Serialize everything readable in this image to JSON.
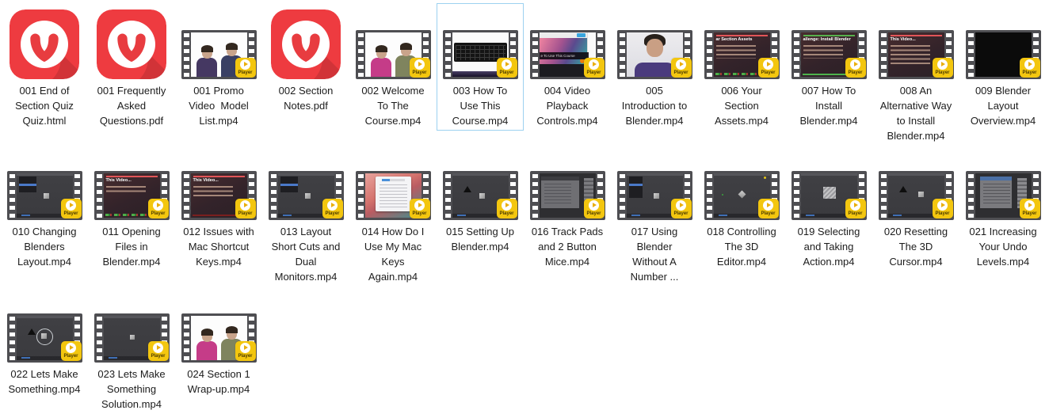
{
  "app": {
    "background": "#ffffff",
    "selection_border": "#9cd1f0",
    "label_color": "#1c1c1c"
  },
  "player_badge": {
    "label": "Player",
    "color": "#f3c60f"
  },
  "icons": {
    "vivaldi_red": "#ee3b40",
    "film_gray": "#4e4e52"
  },
  "files": {
    "rows": [
      {
        "items": [
          {
            "name": "001 End of Section Quiz Quiz.html",
            "icon": "vivaldi"
          },
          {
            "name": "001 Frequently Asked Questions.pdf",
            "icon": "vivaldi"
          },
          {
            "name": "001 Promo Video  Model List.mp4",
            "icon": "film",
            "thumb": "men-dark"
          },
          {
            "name": "002 Section Notes.pdf",
            "icon": "vivaldi"
          },
          {
            "name": "002 Welcome To The Course.mp4",
            "icon": "film",
            "thumb": "men-pink"
          },
          {
            "name": "003 How To Use This Course.mp4",
            "icon": "film",
            "thumb": "keyboard",
            "selected": true
          },
          {
            "name": "004 Video Playback Controls.mp4",
            "icon": "film",
            "thumb": "splash",
            "thumb_text": "e To Use This Course"
          },
          {
            "name": "005 Introduction to Blender.mp4",
            "icon": "film",
            "thumb": "portrait"
          },
          {
            "name": "006 Your Section Assets.mp4",
            "icon": "film",
            "thumb": "slide-a",
            "thumb_text": "ar Section Assets"
          },
          {
            "name": "007 How To Install Blender.mp4",
            "icon": "film",
            "thumb": "slide-b",
            "thumb_text": "allenge: Install Blender"
          },
          {
            "name": "008 An Alternative Way to Install Blender.mp4",
            "icon": "film",
            "thumb": "slide-c",
            "thumb_text": "This Video..."
          },
          {
            "name": "009 Blender Layout Overview.mp4",
            "icon": "film",
            "thumb": "black"
          }
        ]
      },
      {
        "items": [
          {
            "name": "010 Changing Blenders Layout.mp4",
            "icon": "film",
            "thumb": "bui"
          },
          {
            "name": "011 Opening Files in Blender.mp4",
            "icon": "film",
            "thumb": "slide-d",
            "thumb_text": "This Video..."
          },
          {
            "name": "012 Issues with Mac Shortcut Keys.mp4",
            "icon": "film",
            "thumb": "slide-e",
            "thumb_text": "This Video..."
          },
          {
            "name": "013 Layout Short Cuts and Dual Monitors.mp4",
            "icon": "film",
            "thumb": "bui"
          },
          {
            "name": "014 How Do I Use My Mac Keys Again.mp4",
            "icon": "film",
            "thumb": "mac"
          },
          {
            "name": "015 Setting Up Blender.mp4",
            "icon": "film",
            "thumb": "v3-cube"
          },
          {
            "name": "016 Track Pads and 2 Button Mice.mp4",
            "icon": "film",
            "thumb": "prefs-a"
          },
          {
            "name": "017 Using Blender Without A Number ...",
            "icon": "film",
            "thumb": "bui-b"
          },
          {
            "name": "018 Controlling The 3D Editor.mp4",
            "icon": "film",
            "thumb": "v3-diamond"
          },
          {
            "name": "019 Selecting and Taking Action.mp4",
            "icon": "film",
            "thumb": "v3-bigcube"
          },
          {
            "name": "020 Resetting The 3D Cursor.mp4",
            "icon": "film",
            "thumb": "v3-cube-r"
          },
          {
            "name": "021 Increasing Your Undo Levels.mp4",
            "icon": "film",
            "thumb": "prefs-b"
          }
        ]
      },
      {
        "items": [
          {
            "name": "022 Lets Make Something.mp4",
            "icon": "film",
            "thumb": "v3-circle"
          },
          {
            "name": "023 Lets Make Something Solution.mp4",
            "icon": "film",
            "thumb": "v3-cube-sm"
          },
          {
            "name": "024 Section 1 Wrap-up.mp4",
            "icon": "film",
            "thumb": "men-pink"
          }
        ]
      }
    ]
  }
}
